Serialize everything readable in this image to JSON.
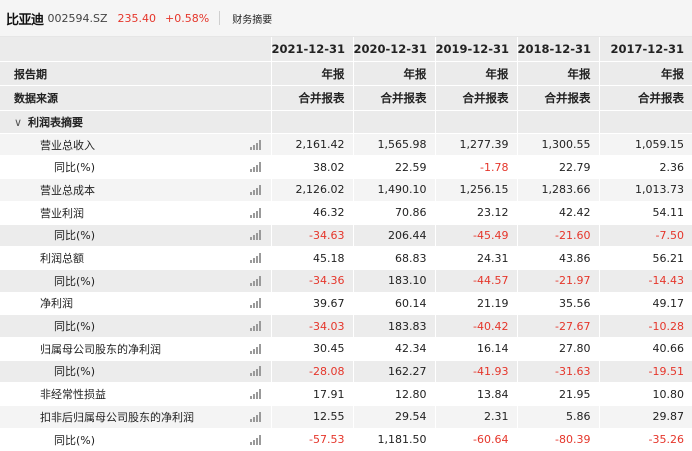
{
  "header": {
    "company": "比亚迪",
    "code": "002594.SZ",
    "price": "235.40",
    "change": "+0.58%",
    "tab": "财务摘要"
  },
  "table": {
    "row_labels": [
      "",
      "报告期",
      "数据来源"
    ],
    "periods": [
      "2021-12-31",
      "2020-12-31",
      "2019-12-31",
      "2018-12-31",
      "2017-12-31"
    ],
    "report_types": [
      "年报",
      "年报",
      "年报",
      "年报",
      "年报"
    ],
    "sources": [
      "合并报表",
      "合并报表",
      "合并报表",
      "合并报表",
      "合并报表"
    ],
    "section_title": "利润表摘要",
    "rows": [
      {
        "label": "营业总收入",
        "values": [
          "2,161.42",
          "1,565.98",
          "1,277.39",
          "1,300.55",
          "1,059.15"
        ]
      },
      {
        "label": "同比(%)",
        "values": [
          "38.02",
          "22.59",
          "-1.78",
          "22.79",
          "2.36"
        ]
      },
      {
        "label": "营业总成本",
        "values": [
          "2,126.02",
          "1,490.10",
          "1,256.15",
          "1,283.66",
          "1,013.73"
        ]
      },
      {
        "label": "营业利润",
        "values": [
          "46.32",
          "70.86",
          "23.12",
          "42.42",
          "54.11"
        ]
      },
      {
        "label": "同比(%)",
        "values": [
          "-34.63",
          "206.44",
          "-45.49",
          "-21.60",
          "-7.50"
        ]
      },
      {
        "label": "利润总额",
        "values": [
          "45.18",
          "68.83",
          "24.31",
          "43.86",
          "56.21"
        ]
      },
      {
        "label": "同比(%)",
        "values": [
          "-34.36",
          "183.10",
          "-44.57",
          "-21.97",
          "-14.43"
        ]
      },
      {
        "label": "净利润",
        "values": [
          "39.67",
          "60.14",
          "21.19",
          "35.56",
          "49.17"
        ]
      },
      {
        "label": "同比(%)",
        "values": [
          "-34.03",
          "183.83",
          "-40.42",
          "-27.67",
          "-10.28"
        ]
      },
      {
        "label": "归属母公司股东的净利润",
        "values": [
          "30.45",
          "42.34",
          "16.14",
          "27.80",
          "40.66"
        ]
      },
      {
        "label": "同比(%)",
        "values": [
          "-28.08",
          "162.27",
          "-41.93",
          "-31.63",
          "-19.51"
        ]
      },
      {
        "label": "非经常性损益",
        "values": [
          "17.91",
          "12.80",
          "13.84",
          "21.95",
          "10.80"
        ]
      },
      {
        "label": "扣非后归属母公司股东的净利润",
        "values": [
          "12.55",
          "29.54",
          "2.31",
          "5.86",
          "29.87"
        ]
      },
      {
        "label": "同比(%)",
        "values": [
          "-57.53",
          "1,181.50",
          "-60.64",
          "-80.39",
          "-35.26"
        ]
      }
    ]
  },
  "colors": {
    "negative": "#e5362b",
    "header_bg": "#ebebeb",
    "stripe": "#f4f4f4"
  }
}
